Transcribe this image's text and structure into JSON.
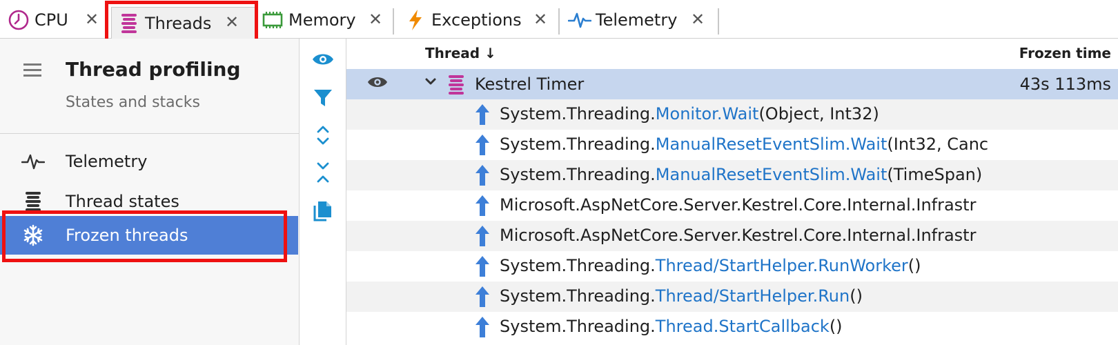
{
  "tabs": [
    {
      "label": "CPU",
      "icon": "clock-icon",
      "active": false
    },
    {
      "label": "Threads",
      "icon": "threads-icon",
      "active": true
    },
    {
      "label": "Memory",
      "icon": "memory-chip-icon",
      "active": false
    },
    {
      "label": "Exceptions",
      "icon": "lightning-icon",
      "active": false
    },
    {
      "label": "Telemetry",
      "icon": "pulse-icon",
      "active": false
    }
  ],
  "sidebar": {
    "title": "Thread profiling",
    "subtitle": "States and stacks",
    "items": [
      {
        "label": "Telemetry",
        "icon": "pulse-icon",
        "selected": false
      },
      {
        "label": "Thread states",
        "icon": "thread-stack-icon",
        "selected": false
      },
      {
        "label": "Frozen threads",
        "icon": "snowflake-icon",
        "selected": true
      }
    ]
  },
  "toolbar": {
    "tools": [
      "eye-icon",
      "filter-icon",
      "expand-all-icon",
      "collapse-all-icon",
      "copy-icon"
    ]
  },
  "table": {
    "columns": {
      "thread": "Thread ↓",
      "frozen_time": "Frozen time"
    },
    "thread_row": {
      "name": "Kestrel Timer",
      "frozen_time": "43s 113ms"
    },
    "frames": [
      {
        "ns": "System.Threading.",
        "method": "Monitor.Wait",
        "args": "(Object, Int32)"
      },
      {
        "ns": "System.Threading.",
        "method": "ManualResetEventSlim.Wait",
        "args": "(Int32, Canc"
      },
      {
        "ns": "System.Threading.",
        "method": "ManualResetEventSlim.Wait",
        "args": "(TimeSpan)"
      },
      {
        "ns": "Microsoft.AspNetCore.Server.Kestrel.Core.Internal.Infrastr",
        "method": "",
        "args": ""
      },
      {
        "ns": "Microsoft.AspNetCore.Server.Kestrel.Core.Internal.Infrastr",
        "method": "",
        "args": ""
      },
      {
        "ns": "System.Threading.",
        "method": "Thread/StartHelper.RunWorker",
        "args": "()"
      },
      {
        "ns": "System.Threading.",
        "method": "Thread/StartHelper.Run",
        "args": "()"
      },
      {
        "ns": "System.Threading.",
        "method": "Thread.StartCallback",
        "args": "()"
      }
    ]
  },
  "colors": {
    "accent": "#4f7fd6",
    "link": "#1f74c8",
    "highlight_box": "#ee1111",
    "selected_row": "#c6d6ee",
    "threads_icon": "#c0359a"
  }
}
